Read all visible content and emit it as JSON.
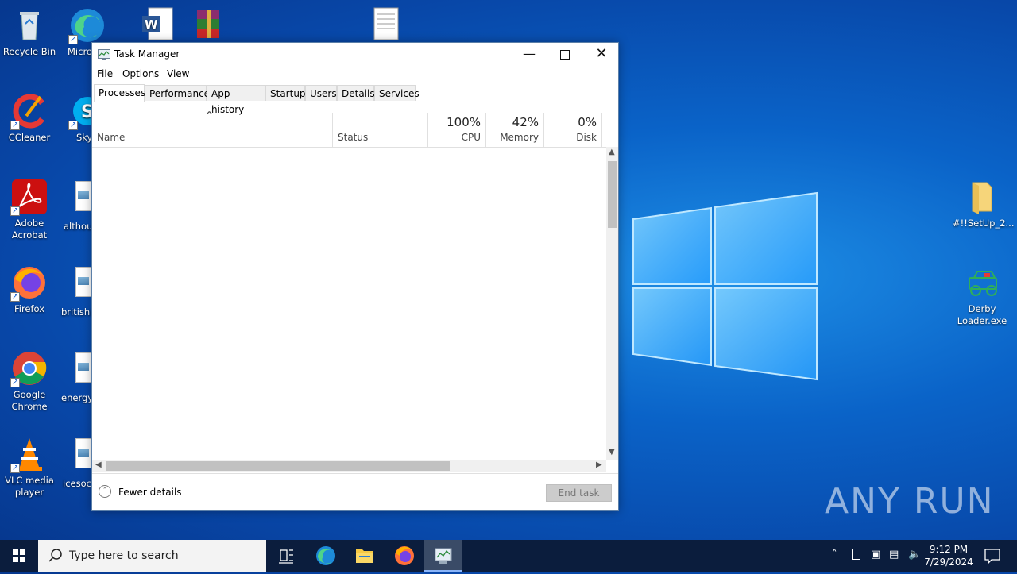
{
  "desktop": {
    "icons_left": [
      {
        "label": "Recycle Bin"
      },
      {
        "label": "Microsoft Edge"
      },
      {
        "label": "CCleaner"
      },
      {
        "label": "Skype"
      },
      {
        "label": "Adobe Acrobat"
      },
      {
        "label": "althou"
      },
      {
        "label": "Firefox"
      },
      {
        "label": "britishi"
      },
      {
        "label": "Google Chrome"
      },
      {
        "label": "energyc"
      },
      {
        "label": "VLC media player"
      },
      {
        "label": "icesoci"
      }
    ],
    "icons_right": [
      {
        "label": "#!!SetUp_2..."
      },
      {
        "label": "Derby Loader.exe"
      }
    ],
    "watermark": "ANY RUN"
  },
  "task_manager": {
    "title": "Task Manager",
    "menu": [
      "File",
      "Options",
      "View"
    ],
    "tabs": [
      "Processes",
      "Performance",
      "App history",
      "Startup",
      "Users",
      "Details",
      "Services"
    ],
    "active_tab": "Processes",
    "columns": {
      "name": "Name",
      "status": "Status",
      "cpu_value": "100%",
      "cpu_label": "CPU",
      "memory_value": "42%",
      "memory_label": "Memory",
      "disk_value": "0%",
      "disk_label": "Disk"
    },
    "footer": {
      "fewer_details": "Fewer details",
      "end_task": "End task"
    }
  },
  "taskbar": {
    "search_placeholder": "Type here to search",
    "time": "9:12 PM",
    "date": "7/29/2024"
  }
}
